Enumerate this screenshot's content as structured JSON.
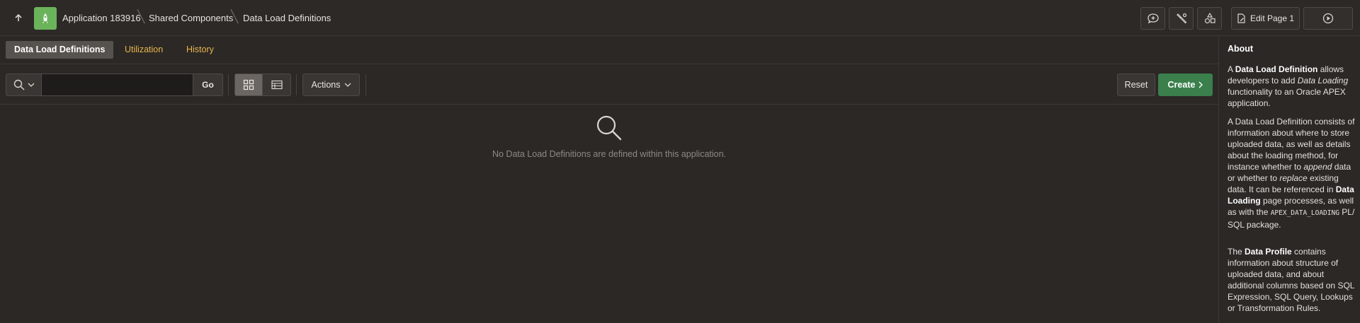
{
  "breadcrumb": {
    "app": "Application 183916",
    "shared": "Shared Components",
    "current": "Data Load Definitions"
  },
  "toolbar_right": {
    "edit_page_label": "Edit Page 1"
  },
  "tabs": [
    {
      "label": "Data Load Definitions",
      "active": true
    },
    {
      "label": "Utilization",
      "active": false
    },
    {
      "label": "History",
      "active": false
    }
  ],
  "toolbar": {
    "search_value": "",
    "go_label": "Go",
    "actions_label": "Actions",
    "reset_label": "Reset",
    "create_label": "Create"
  },
  "empty_state": {
    "message": "No Data Load Definitions are defined within this application."
  },
  "about": {
    "title": "About",
    "p1": {
      "a": "A ",
      "b1": "Data Load Definition",
      "c": " allows developers to add ",
      "i1": "Data Loading",
      "d": " functionality to an Oracle APEX application."
    },
    "p2": {
      "a": "A Data Load Definition consists of information about where to store uploaded data, as well as details about the loading method, for instance whether to ",
      "i1": "append",
      "b": " data or whether to ",
      "i2": "replace",
      "c": " existing data. It can be referenced in ",
      "b1": "Data Loading",
      "d": " page processes, as well as with the ",
      "code": "APEX_DATA_LOADING",
      "e": " PL/ SQL package."
    },
    "p3": {
      "a": "The ",
      "b1": "Data Profile",
      "c": " contains information about structure of uploaded data, and about additional columns based on SQL Expression, SQL Query, Lookups or Transformation Rules."
    }
  },
  "colors": {
    "accent_tab": "#e8b64b",
    "create_button": "#3a7f4c",
    "app_icon": "#6bb35a"
  }
}
